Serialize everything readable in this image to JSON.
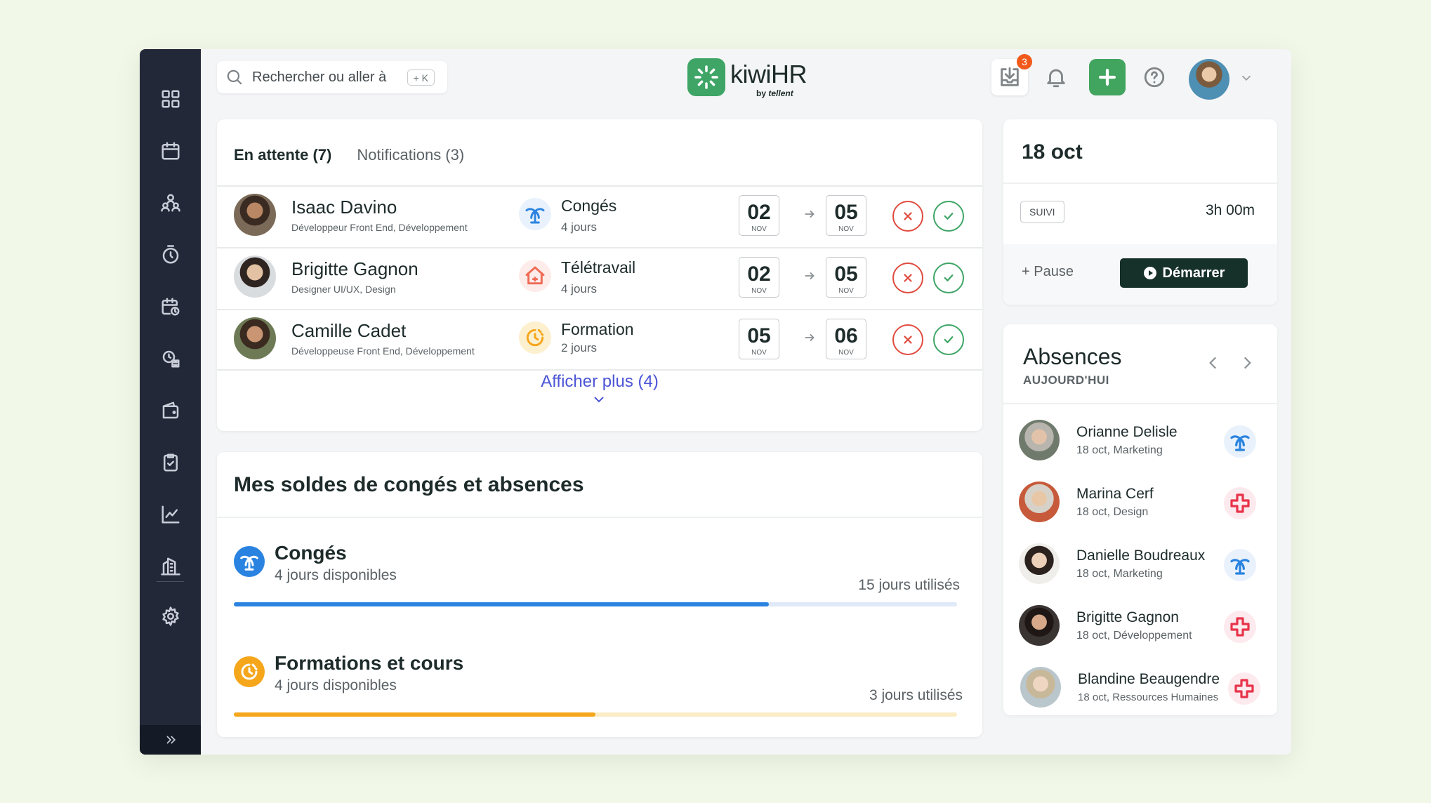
{
  "colors": {
    "sidebar": "#232839",
    "brand_green": "#41a45f",
    "dark_green": "#16302a",
    "reject_red": "#e04b3f",
    "approve_green": "#3ea566",
    "link_blue": "#4b55d6",
    "conges_blue": "#2a83e0",
    "formation_orange": "#f5a61b"
  },
  "sidebar": {
    "items": [
      "dashboard-icon",
      "calendar-icon",
      "people-icon",
      "timer-icon",
      "calendar-clock-icon",
      "gear-clock-icon",
      "wallet-icon",
      "clipboard-check-icon",
      "chart-icon",
      "building-icon"
    ],
    "settings": "settings-icon",
    "expand": "double-chevron-right-icon"
  },
  "header": {
    "search_placeholder": "Rechercher ou aller à",
    "search_shortcut": "+ K",
    "logo_name": "kiwiHR",
    "logo_by": "by",
    "logo_brand": "tellent",
    "inbox_badge": "3"
  },
  "pending": {
    "tabs": [
      {
        "label": "En attente (7)",
        "active": true
      },
      {
        "label": "Notifications (3)",
        "active": false
      }
    ],
    "requests": [
      {
        "name": "Isaac Davino",
        "role": "Développeur Front End, Développement",
        "type": "Congés",
        "days": "4 jours",
        "from_day": "02",
        "from_month": "NOV",
        "to_day": "05",
        "to_month": "NOV"
      },
      {
        "name": "Brigitte Gagnon",
        "role": "Designer UI/UX, Design",
        "type": "Télétravail",
        "days": "4 jours",
        "from_day": "02",
        "from_month": "NOV",
        "to_day": "05",
        "to_month": "NOV"
      },
      {
        "name": "Camille Cadet",
        "role": "Développeuse Front End, Développement",
        "type": "Formation",
        "days": "2 jours",
        "from_day": "05",
        "from_month": "NOV",
        "to_day": "06",
        "to_month": "NOV"
      }
    ],
    "show_more": "Afficher plus (4)"
  },
  "balances": {
    "title": "Mes soldes de congés et absences",
    "items": [
      {
        "name": "Congés",
        "available": "4 jours disponibles",
        "used": "15 jours utilisés",
        "fill_fraction": 0.74
      },
      {
        "name": "Formations et cours",
        "available": "4 jours disponibles",
        "used": "3 jours utilisés",
        "fill_fraction": 0.5
      }
    ]
  },
  "clock": {
    "date": "18 oct",
    "tag": "SUIVI",
    "time": "3h 00m",
    "pause_label": "+ Pause",
    "start_label": "Démarrer"
  },
  "absences": {
    "title": "Absences",
    "subtitle": "AUJOURD'HUI",
    "people": [
      {
        "name": "Orianne Delisle",
        "meta": "18 oct, Marketing",
        "type": "conges"
      },
      {
        "name": "Marina Cerf",
        "meta": "18 oct, Design",
        "type": "maladie"
      },
      {
        "name": "Danielle Boudreaux",
        "meta": "18 oct, Marketing",
        "type": "conges"
      },
      {
        "name": "Brigitte Gagnon",
        "meta": "18 oct, Développement",
        "type": "maladie"
      },
      {
        "name": "Blandine Beaugendre",
        "meta": "18 oct, Ressources Humaines",
        "type": "maladie"
      }
    ]
  }
}
